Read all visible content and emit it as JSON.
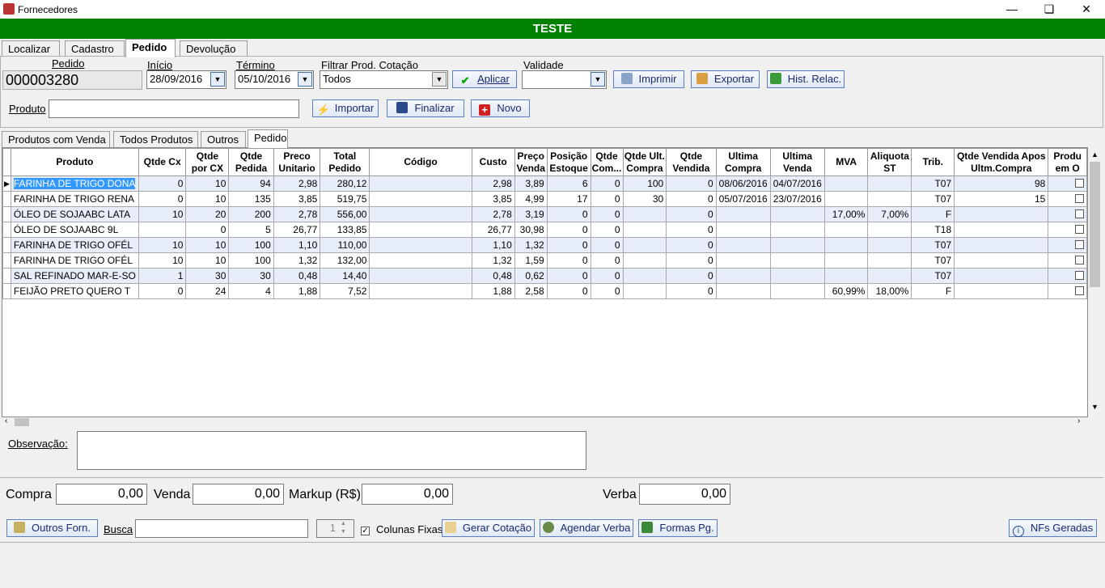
{
  "window": {
    "title": "Fornecedores",
    "minimize": "—",
    "maximize": "❏",
    "close": "✕"
  },
  "banner": "TESTE",
  "main_tabs": [
    "Localizar",
    "Cadastro",
    "Pedido",
    "Devolução"
  ],
  "header": {
    "pedido_label": "Pedido",
    "pedido_value": "000003280",
    "inicio_label": "Início",
    "inicio_value": "28/09/2016",
    "termino_label": "Término",
    "termino_value": "05/10/2016",
    "filtro_label": "Filtrar Prod. Cotação",
    "filtro_value": "Todos",
    "aplicar": "Aplicar",
    "validade_label": "Validade",
    "validade_value": "",
    "imprimir": "Imprimir",
    "exportar": "Exportar",
    "hist": "Hist. Relac.",
    "produto_label": "Produto",
    "produto_value": "",
    "importar": "Importar",
    "finalizar": "Finalizar",
    "novo": "Novo"
  },
  "sub_tabs": [
    "Produtos com Venda",
    "Todos Produtos",
    "Outros",
    "Pedido"
  ],
  "columns": [
    "Produto",
    "Qtde Cx",
    "Qtde por CX",
    "Qtde Pedida",
    "Preco Unitario",
    "Total Pedido",
    "Código",
    "Custo",
    "Preço Venda",
    "Posição Estoque",
    "Qtde Com...",
    "Qtde Ult. Compra",
    "Qtde Vendida",
    "Ultima Compra",
    "Ultima Venda",
    "MVA",
    "Aliquota ST",
    "Trib.",
    "Qtde Vendida Apos Ultm.Compra",
    "Produ em O"
  ],
  "rows": [
    [
      "FARINHA DE TRIGO DONA",
      "0",
      "10",
      "94",
      "2,98",
      "280,12",
      "",
      "2,98",
      "3,89",
      "6",
      "0",
      "100",
      "0",
      "08/06/2016",
      "04/07/2016",
      "",
      "",
      "T07",
      "98",
      ""
    ],
    [
      "FARINHA DE TRIGO RENA",
      "0",
      "10",
      "135",
      "3,85",
      "519,75",
      "",
      "3,85",
      "4,99",
      "17",
      "0",
      "30",
      "0",
      "05/07/2016",
      "23/07/2016",
      "",
      "",
      "T07",
      "15",
      ""
    ],
    [
      "ÓLEO DE SOJAABC LATA",
      "10",
      "20",
      "200",
      "2,78",
      "556,00",
      "",
      "2,78",
      "3,19",
      "0",
      "0",
      "",
      "0",
      "",
      "",
      "17,00%",
      "7,00%",
      "F",
      "",
      ""
    ],
    [
      "ÓLEO DE SOJAABC 9L",
      "",
      "0",
      "5",
      "26,77",
      "133,85",
      "",
      "26,77",
      "30,98",
      "0",
      "0",
      "",
      "0",
      "",
      "",
      "",
      "",
      "T18",
      "",
      ""
    ],
    [
      "FARINHA DE TRIGO OFÉL",
      "10",
      "10",
      "100",
      "1,10",
      "110,00",
      "",
      "1,10",
      "1,32",
      "0",
      "0",
      "",
      "0",
      "",
      "",
      "",
      "",
      "T07",
      "",
      ""
    ],
    [
      "FARINHA DE TRIGO OFÉL",
      "10",
      "10",
      "100",
      "1,32",
      "132,00",
      "",
      "1,32",
      "1,59",
      "0",
      "0",
      "",
      "0",
      "",
      "",
      "",
      "",
      "T07",
      "",
      ""
    ],
    [
      "SAL REFINADO MAR-E-SO",
      "1",
      "30",
      "30",
      "0,48",
      "14,40",
      "",
      "0,48",
      "0,62",
      "0",
      "0",
      "",
      "0",
      "",
      "",
      "",
      "",
      "T07",
      "",
      ""
    ],
    [
      "FEIJÃO PRETO QUERO T",
      "0",
      "24",
      "4",
      "1,88",
      "7,52",
      "",
      "1,88",
      "2,58",
      "0",
      "0",
      "",
      "0",
      "",
      "",
      "60,99%",
      "18,00%",
      "F",
      "",
      ""
    ]
  ],
  "observacao_label": "Observação:",
  "observacao_value": "",
  "totals": {
    "compra_label": "Compra",
    "compra_value": "0,00",
    "venda_label": "Venda",
    "venda_value": "0,00",
    "markup_label": "Markup (R$)",
    "markup_value": "0,00",
    "verba_label": "Verba",
    "verba_value": "0,00"
  },
  "footer": {
    "outros_forn": "Outros Forn.",
    "busca_label": "Busca",
    "busca_value": "",
    "spin_value": "1",
    "colunas_fixas": "Colunas Fixas",
    "gerar_cotacao": "Gerar Cotação",
    "agendar_verba": "Agendar Verba",
    "formas_pg": "Formas Pg.",
    "nfs_geradas": "NFs Geradas"
  }
}
